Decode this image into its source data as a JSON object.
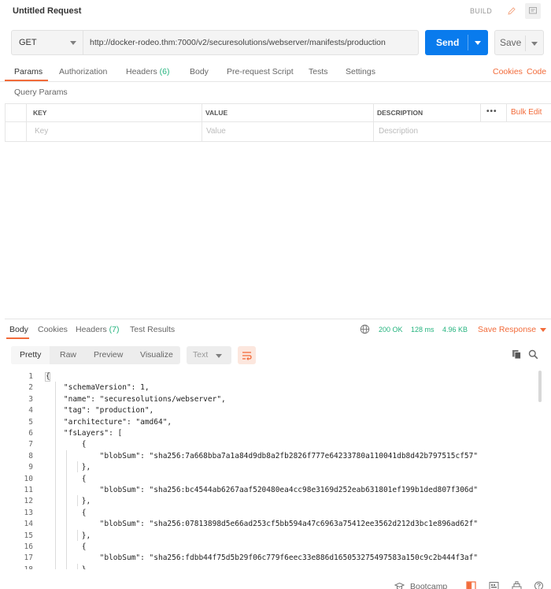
{
  "header": {
    "title": "Untitled Request",
    "build_label": "BUILD"
  },
  "request": {
    "method": "GET",
    "url": "http://docker-rodeo.thm:7000/v2/securesolutions/webserver/manifests/production",
    "send_label": "Send",
    "save_label": "Save"
  },
  "request_tabs": {
    "params": "Params",
    "authorization": "Authorization",
    "headers": "Headers",
    "headers_count": "(6)",
    "body": "Body",
    "prerequest": "Pre-request Script",
    "tests": "Tests",
    "settings": "Settings",
    "cookies": "Cookies",
    "code": "Code"
  },
  "params": {
    "section_label": "Query Params",
    "col_key": "KEY",
    "col_value": "VALUE",
    "col_description": "DESCRIPTION",
    "more": "•••",
    "bulk_edit": "Bulk Edit",
    "key_placeholder": "Key",
    "value_placeholder": "Value",
    "description_placeholder": "Description"
  },
  "response_tabs": {
    "body": "Body",
    "cookies": "Cookies",
    "headers": "Headers",
    "headers_count": "(7)",
    "test_results": "Test Results"
  },
  "response_status": {
    "status": "200 OK",
    "time": "128 ms",
    "size": "4.96 KB",
    "save_response": "Save Response"
  },
  "view_modes": {
    "pretty": "Pretty",
    "raw": "Raw",
    "preview": "Preview",
    "visualize": "Visualize",
    "format": "Text"
  },
  "code_lines": [
    {
      "n": "1",
      "text": "{"
    },
    {
      "n": "2",
      "text": "    \"schemaVersion\": 1,"
    },
    {
      "n": "3",
      "text": "    \"name\": \"securesolutions/webserver\","
    },
    {
      "n": "4",
      "text": "    \"tag\": \"production\","
    },
    {
      "n": "5",
      "text": "    \"architecture\": \"amd64\","
    },
    {
      "n": "6",
      "text": "    \"fsLayers\": ["
    },
    {
      "n": "7",
      "text": "        {"
    },
    {
      "n": "8",
      "text": "            \"blobSum\": \"sha256:7a668bba7a1a84d9db8a2fb2826f777e64233780a110041db8d42b797515cf57\""
    },
    {
      "n": "9",
      "text": "        },"
    },
    {
      "n": "10",
      "text": "        {"
    },
    {
      "n": "11",
      "text": "            \"blobSum\": \"sha256:bc4544ab6267aaf520480ea4cc98e3169d252eab631801ef199b1ded807f306d\""
    },
    {
      "n": "12",
      "text": "        },"
    },
    {
      "n": "13",
      "text": "        {"
    },
    {
      "n": "14",
      "text": "            \"blobSum\": \"sha256:07813898d5e66ad253cf5bb594a47c6963a75412ee3562d212d3bc1e896ad62f\""
    },
    {
      "n": "15",
      "text": "        },"
    },
    {
      "n": "16",
      "text": "        {"
    },
    {
      "n": "17",
      "text": "            \"blobSum\": \"sha256:fdbb44f75d5b29f06c779f6eec33e886d165053275497583a150c9c2b444f3af\""
    },
    {
      "n": "18",
      "text": "        }"
    }
  ],
  "statusbar": {
    "bootcamp": "Bootcamp"
  },
  "colors": {
    "accent": "#f26b3a",
    "primary": "#097bed",
    "success": "#26b47f"
  }
}
